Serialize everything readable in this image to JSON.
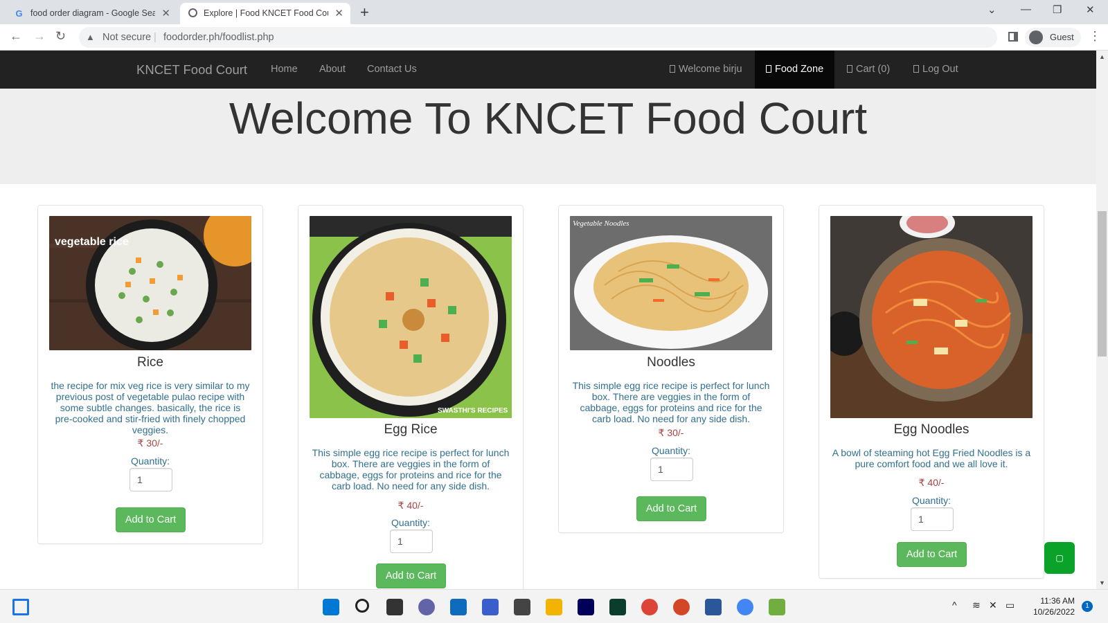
{
  "browser": {
    "tabs": [
      {
        "title": "food order diagram - Google Search",
        "favicon": "google-icon",
        "active": false
      },
      {
        "title": "Explore | Food KNCET Food Court",
        "favicon": "globe-icon",
        "active": true
      }
    ],
    "security_label": "Not secure",
    "url": "foodorder.ph/foodlist.php",
    "profile_label": "Guest"
  },
  "site": {
    "brand": "KNCET Food Court",
    "nav_left": [
      "Home",
      "About",
      "Contact Us"
    ],
    "nav_right": [
      "Welcome birju",
      "Food Zone",
      "Cart (0)",
      "Log Out"
    ],
    "active_nav": "Food Zone",
    "heading": "Welcome To KNCET Food Court"
  },
  "products": [
    {
      "name": "Rice",
      "description": "the recipe for mix veg rice is very similar to my previous post of vegetable pulao recipe with some subtle changes. basically, the rice is pre-cooked and stir-fried with finely chopped veggies.",
      "price": "₹ 30/-",
      "quantity_label": "Quantity:",
      "quantity": "1",
      "button": "Add to Cart",
      "image_caption": "vegetable rice"
    },
    {
      "name": "Egg Rice",
      "description": "This simple egg rice recipe is perfect for lunch box. There are veggies in the form of cabbage, eggs for proteins and rice for the carb load. No need for any side dish.",
      "price": "₹ 40/-",
      "quantity_label": "Quantity:",
      "quantity": "1",
      "button": "Add to Cart",
      "image_caption": "SWASTHI'S RECIPES"
    },
    {
      "name": "Noodles",
      "description": "This simple egg rice recipe is perfect for lunch box. There are veggies in the form of cabbage, eggs for proteins and rice for the carb load. No need for any side dish.",
      "price": "₹ 30/-",
      "quantity_label": "Quantity:",
      "quantity": "1",
      "button": "Add to Cart",
      "image_caption": "Vegetable Noodles"
    },
    {
      "name": "Egg Noodles",
      "description": "A bowl of steaming hot Egg Fried Noodles is a pure comfort food and we all love it.",
      "price": "₹ 40/-",
      "quantity_label": "Quantity:",
      "quantity": "1",
      "button": "Add to Cart",
      "image_caption": ""
    }
  ],
  "taskbar": {
    "time": "11:36 AM",
    "date": "10/26/2022",
    "notification_count": "1"
  },
  "colors": {
    "navbar": "#222222",
    "jumbotron": "#eeeeee",
    "button_green": "#5cb85c",
    "description_text": "#31708f",
    "price_text": "#a94442"
  }
}
